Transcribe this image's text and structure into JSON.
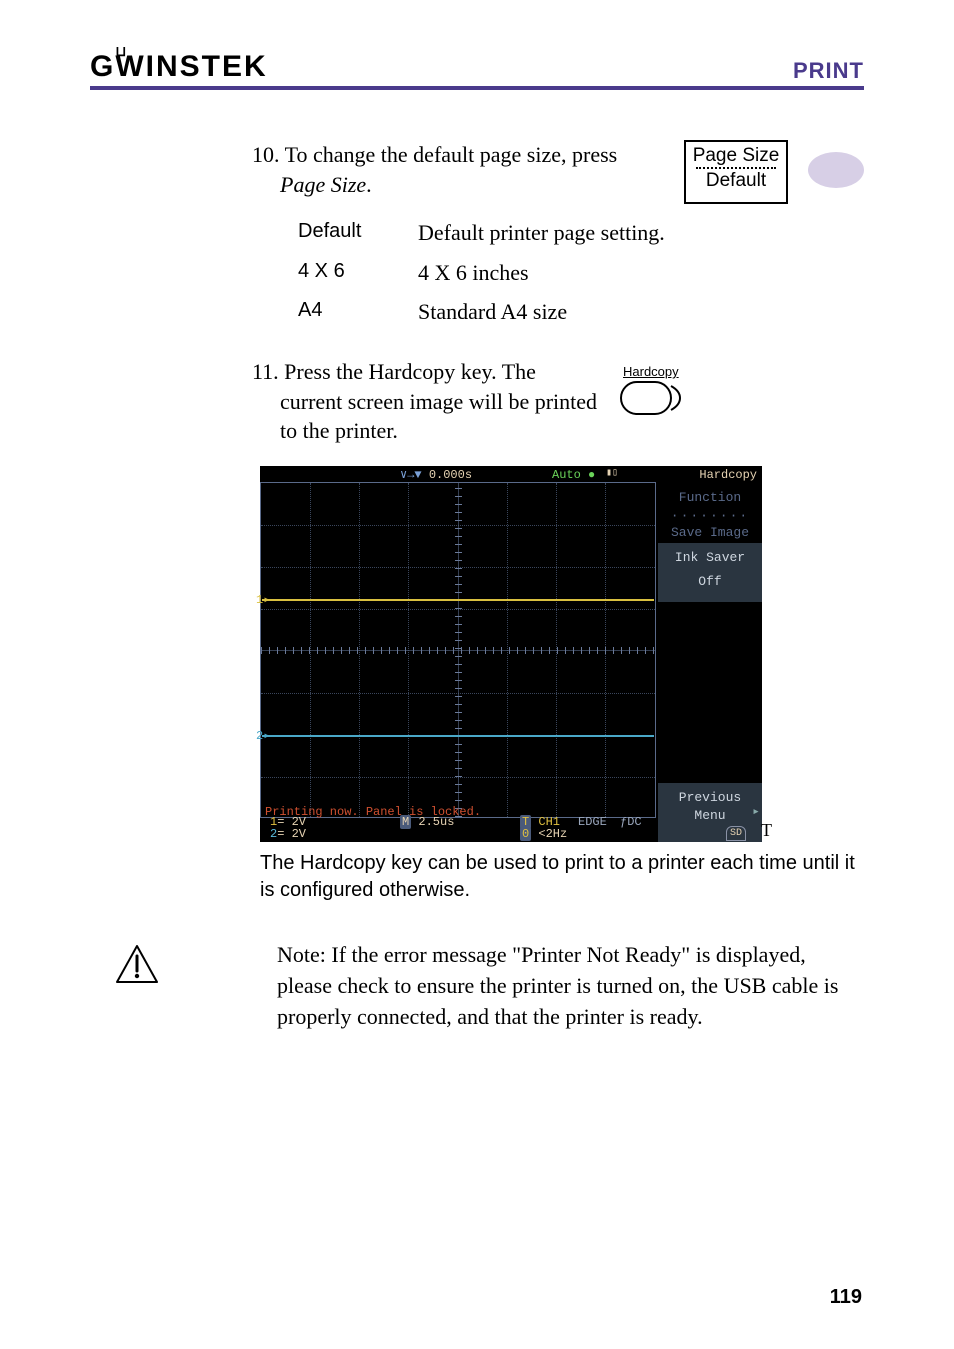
{
  "header": {
    "brand_pre": "G",
    "brand_mid": "W",
    "brand_post": "INSTEK",
    "section": "PRINT"
  },
  "step10": {
    "text_a": "10. To change the default page size, press ",
    "text_b": "Page Size",
    "text_c": ".",
    "softkey_top": "Page Size",
    "softkey_bottom": "Default"
  },
  "options": [
    {
      "key": "Default",
      "desc": "Default printer page setting."
    },
    {
      "key": "4 X 6",
      "desc": "4 X 6 inches"
    },
    {
      "key": "A4",
      "desc": "Standard A4 size"
    }
  ],
  "step11": {
    "text_a": "11. Press the Hardcopy key. The current screen image will be printed to the printer.",
    "key_label": "Hardcopy"
  },
  "screenshot": {
    "time": "0.000s",
    "auto": "Auto",
    "title": "Hardcopy",
    "side": {
      "function_lbl": "Function",
      "function_dots": "········",
      "function_val": "Save Image",
      "ink_lbl": "Ink Saver",
      "ink_val": "Off",
      "prev_lbl": "Previous",
      "prev_val": "Menu"
    },
    "msg": "Printing now. Panel is locked.",
    "ch1": {
      "n": "1",
      "v": "= 2V"
    },
    "ch2": {
      "n": "2",
      "v": "= 2V"
    },
    "m": "2.5us",
    "m_prefix": "M",
    "tch1": "CH1",
    "tch1_prefix": "T",
    "thz": "<2Hz",
    "thz_prefix": "0",
    "edge": "EDGE",
    "fdc": "ƒDC",
    "sd": "SD",
    "marker1": "1",
    "marker2": "2",
    "outT": "T"
  },
  "caption": "The Hardcopy key can be used to print to a printer each time until it is configured otherwise.",
  "note": "Note: If the error message \"Printer Not Ready\" is displayed, please check to ensure the printer is turned on, the USB cable is properly connected, and that the printer is ready.",
  "page_number": "119"
}
